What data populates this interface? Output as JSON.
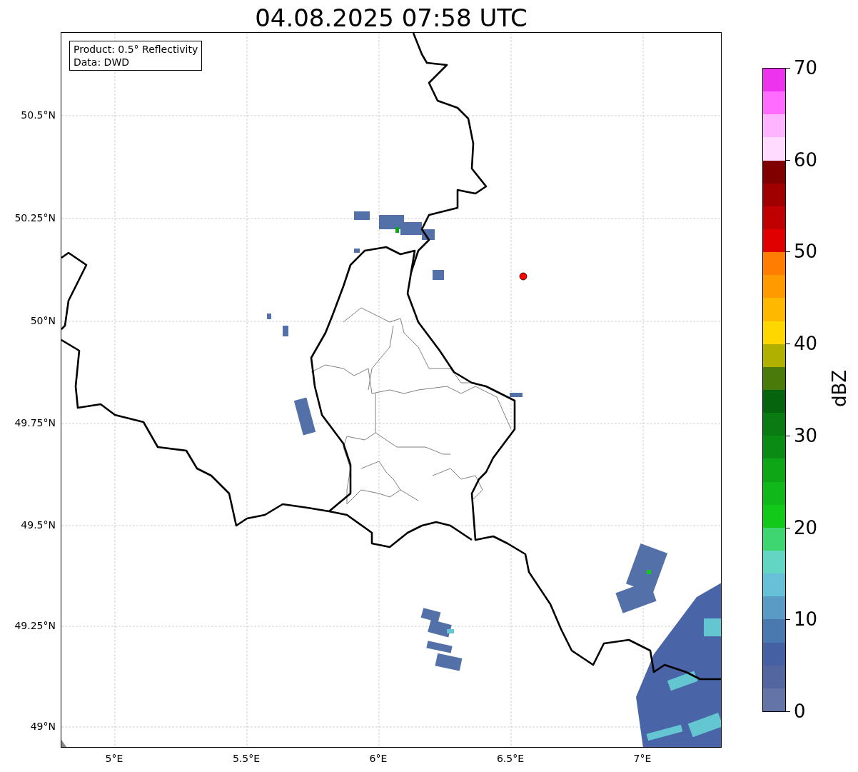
{
  "title": "04.08.2025 07:58 UTC",
  "info_box": [
    "Product: 0.5° Reflectivity",
    "Data: DWD"
  ],
  "lat_ticks": [
    "50.5°N",
    "50.25°N",
    "50°N",
    "49.75°N",
    "49.5°N",
    "49.25°N",
    "49°N"
  ],
  "lon_ticks": [
    "5°E",
    "5.5°E",
    "6°E",
    "6.5°E",
    "7°E"
  ],
  "colorbar": {
    "label": "dBZ",
    "ticks": [
      "70",
      "60",
      "50",
      "40",
      "30",
      "20",
      "10",
      "0"
    ],
    "segments": [
      {
        "color": "#6574a6"
      },
      {
        "color": "#5466a0"
      },
      {
        "color": "#4560a3"
      },
      {
        "color": "#4a79b0"
      },
      {
        "color": "#5a9bc5"
      },
      {
        "color": "#65c0d8"
      },
      {
        "color": "#63d6c3"
      },
      {
        "color": "#3ed670"
      },
      {
        "color": "#12c91a"
      },
      {
        "color": "#10b81a"
      },
      {
        "color": "#0ea616"
      },
      {
        "color": "#0a8c14"
      },
      {
        "color": "#0a7a12"
      },
      {
        "color": "#07640e"
      },
      {
        "color": "#4a7a0a"
      },
      {
        "color": "#b0b000"
      },
      {
        "color": "#ffd700"
      },
      {
        "color": "#ffb800"
      },
      {
        "color": "#ff9a00"
      },
      {
        "color": "#ff7d00"
      },
      {
        "color": "#e00000"
      },
      {
        "color": "#c00000"
      },
      {
        "color": "#a00000"
      },
      {
        "color": "#800000"
      },
      {
        "color": "#ffdcff"
      },
      {
        "color": "#ffb4ff"
      },
      {
        "color": "#ff6cff"
      },
      {
        "color": "#ee33ee"
      }
    ]
  }
}
